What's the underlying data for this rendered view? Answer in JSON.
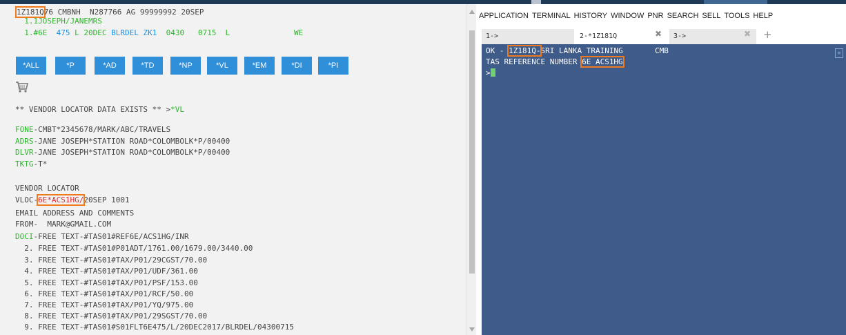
{
  "left": {
    "header": {
      "pnr": "1Z181Q",
      "rest": "76 CMBNH  N287766 AG 99999992 20SEP"
    },
    "name_line": "  1.1JOSEPH/JANEMRS",
    "seg": {
      "prefix": "  1.#6E  ",
      "flight": "475",
      "cls": " L 20DEC ",
      "city": "BLRDEL",
      "status": " ZK1",
      "rest": "  0430   0715  L              WE"
    },
    "buttons": [
      "*ALL",
      "*P",
      "*AD",
      "*TD",
      "*NP",
      "*VL",
      "*EM",
      "*DI",
      "*PI"
    ],
    "vendor_exists": {
      "text": "** VENDOR LOCATOR DATA EXISTS ** >",
      "link": "*VL"
    },
    "fone": {
      "key": "FONE",
      "val": "-CMBT*2345678/MARK/ABC/TRAVELS"
    },
    "adrs": {
      "key": "ADRS",
      "val": "-JANE JOSEPH*STATION ROAD*COLOMBOLK*P/00400"
    },
    "dlvr": {
      "key": "DLVR",
      "val": "-JANE JOSEPH*STATION ROAD*COLOMBOLK*P/00400"
    },
    "tktg": {
      "key": "TKTG",
      "val": "-T*"
    },
    "vendor_locator": "VENDOR LOCATOR",
    "vloc": {
      "pre": "VLOC-",
      "code": "6E*ACS1HG/",
      "post": "20SEP 1001"
    },
    "email_hdr": "EMAIL ADDRESS AND COMMENTS",
    "from": "FROM-  MARK@GMAIL.COM",
    "doci": {
      "key": "DOCI",
      "val": "-FREE TEXT-#TAS01#REF6E/ACS1HG/INR"
    },
    "free_lines": [
      "  2. FREE TEXT-#TAS01#P01ADT/1761.00/1679.00/3440.00",
      "  3. FREE TEXT-#TAS01#TAX/P01/29CGST/70.00",
      "  4. FREE TEXT-#TAS01#TAX/P01/UDF/361.00",
      "  5. FREE TEXT-#TAS01#TAX/P01/PSF/153.00",
      "  6. FREE TEXT-#TAS01#TAX/P01/RCF/50.00",
      "  7. FREE TEXT-#TAS01#TAX/P01/YQ/975.00",
      "  8. FREE TEXT-#TAS01#TAX/P01/29SGST/70.00",
      "  9. FREE TEXT-#TAS01#S01FLT6E475/L/20DEC2017/BLRDEL/04300715"
    ]
  },
  "right": {
    "menu": [
      "APPLICATION",
      "TERMINAL",
      "HISTORY",
      "WINDOW",
      "PNR",
      "SEARCH",
      "SELL",
      "TOOLS",
      "HELP"
    ],
    "tabs": [
      {
        "label": "1->"
      },
      {
        "label": "2-*1Z181Q"
      },
      {
        "label": "3->"
      }
    ],
    "tab_close": "✖",
    "tab_add": "+",
    "terminal": {
      "line1_pre": "OK - ",
      "line1_pnr": "1Z181Q-",
      "line1_post": "SRI LANKA TRAINING       CMB",
      "line2_pre": "TAS REFERENCE NUMBER ",
      "line2_ref": "6E ACS1HG",
      "prompt": ">"
    }
  },
  "colors": {
    "accent": "#2f8fd8",
    "terminal_bg": "#3f5b89",
    "highlight": "#f07a1e",
    "green": "#2db52d"
  },
  "icons": {
    "cart": "shopping-cart-icon",
    "close": "close-icon",
    "add": "plus-icon"
  }
}
